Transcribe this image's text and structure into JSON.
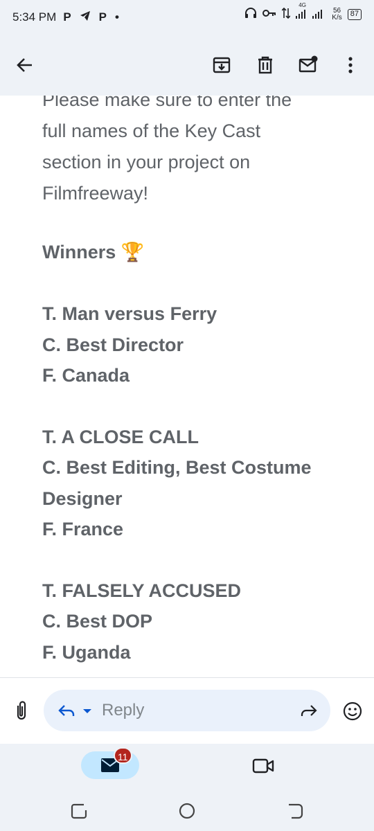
{
  "status_bar": {
    "time": "5:34 PM",
    "left_icons": [
      "p-icon",
      "telegram-icon",
      "p-icon",
      "dot"
    ],
    "network": "4G",
    "speed_value": "56",
    "speed_unit": "K/s",
    "battery": "87"
  },
  "app_bar": {
    "actions": [
      "archive-icon",
      "delete-icon",
      "mark-unread-icon",
      "more-icon"
    ]
  },
  "email": {
    "intro_lines": [
      "Please make sure to enter the",
      "full names of the Key Cast",
      "section in your project on",
      "Filmfreeway!"
    ],
    "winners_label": "Winners 🏆",
    "entries": [
      {
        "title": "T. Man versus Ferry",
        "category": "C. Best Director",
        "country": "F. Canada"
      },
      {
        "title": "T. A CLOSE CALL",
        "category": "C. Best Editing, Best Costume Designer",
        "country": "F. France"
      },
      {
        "title": "T. FALSELY ACCUSED",
        "category": "C. Best DOP",
        "country": "F. Uganda"
      }
    ]
  },
  "compose": {
    "reply_placeholder": "Reply"
  },
  "bottom_nav": {
    "mail_badge": "11"
  },
  "colors": {
    "chrome_bg": "#eef2f7",
    "reply_pill_bg": "#eaf1fb",
    "reply_icon": "#0b57d0",
    "mail_tab_bg": "#c2e7ff",
    "badge_bg": "#b3261e",
    "body_text": "#5f6368"
  }
}
